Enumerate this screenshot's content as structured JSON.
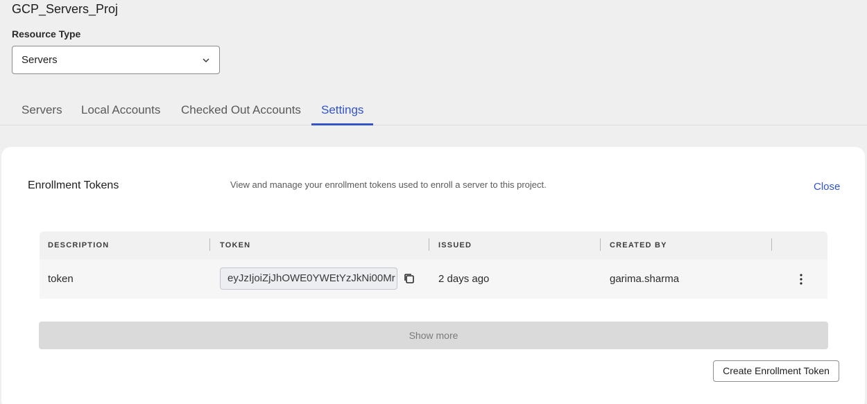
{
  "project": {
    "title": "GCP_Servers_Proj"
  },
  "resource_type": {
    "label": "Resource Type",
    "selected": "Servers",
    "icon": "chevron-down-icon"
  },
  "tabs": [
    {
      "label": "Servers",
      "active": false
    },
    {
      "label": "Local Accounts",
      "active": false
    },
    {
      "label": "Checked Out Accounts",
      "active": false
    },
    {
      "label": "Settings",
      "active": true
    }
  ],
  "enrollment": {
    "title": "Enrollment Tokens",
    "description": "View and manage your enrollment tokens used to enroll a server to this project.",
    "close_label": "Close",
    "columns": [
      "DESCRIPTION",
      "TOKEN",
      "ISSUED",
      "CREATED BY"
    ],
    "rows": [
      {
        "description": "token",
        "token": "eyJzIjoiZjJhOWE0YWEtYzJkNi00Mr",
        "issued": "2 days ago",
        "created_by": "garima.sharma"
      }
    ],
    "show_more_label": "Show more",
    "create_label": "Create Enrollment Token"
  },
  "colors": {
    "accent": "#3353c9",
    "link": "#2f54c7"
  }
}
